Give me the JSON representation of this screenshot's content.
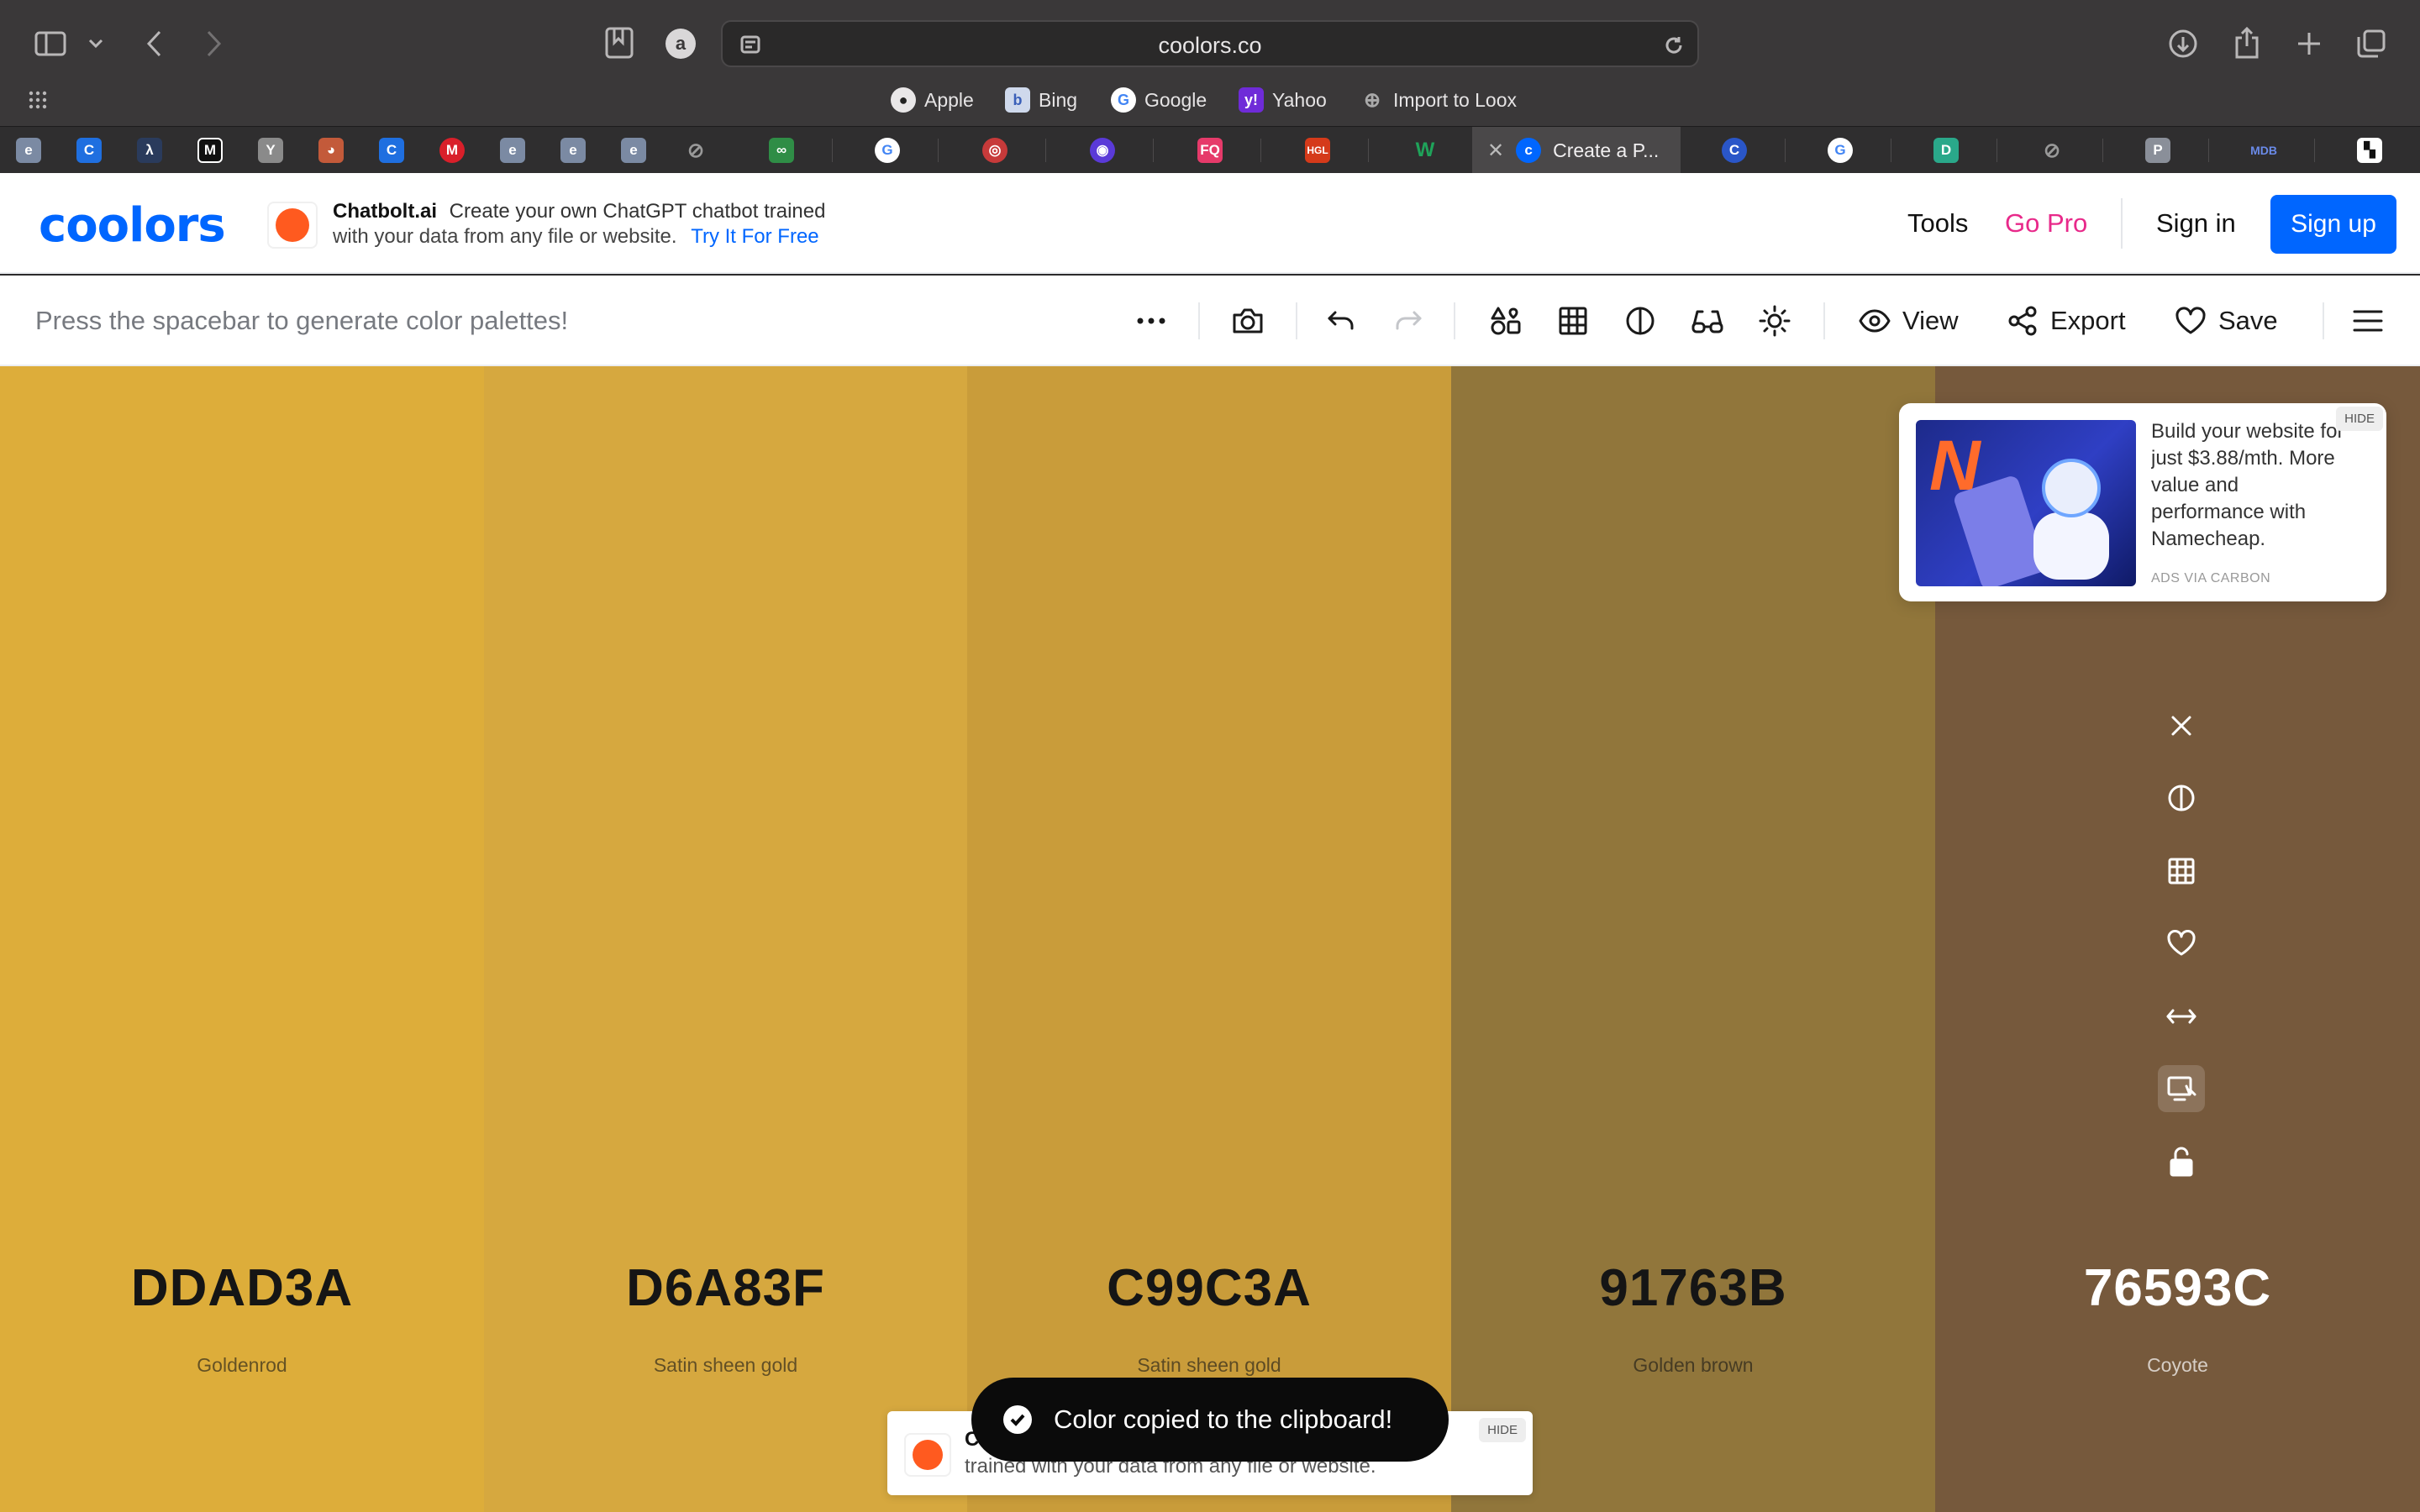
{
  "browser": {
    "url": "coolors.co",
    "bookmarks": [
      {
        "label": "Apple",
        "icon": "apple-icon"
      },
      {
        "label": "Bing",
        "icon": "bing-icon"
      },
      {
        "label": "Google",
        "icon": "google-icon"
      },
      {
        "label": "Yahoo",
        "icon": "yahoo-icon"
      },
      {
        "label": "Import to Loox",
        "icon": "globe-icon"
      }
    ],
    "active_tab": {
      "label": "Create a P..."
    }
  },
  "header": {
    "logo": "coolors",
    "promo": {
      "brand": "Chatbolt.ai",
      "line1": "Create your own ChatGPT chatbot trained",
      "line2": "with your data from any file or website.",
      "cta": "Try It For Free"
    },
    "nav": {
      "tools": "Tools",
      "go_pro": "Go Pro",
      "sign_in": "Sign in",
      "sign_up": "Sign up"
    }
  },
  "generator": {
    "hint": "Press the spacebar to generate color palettes!",
    "view": "View",
    "export": "Export",
    "save": "Save"
  },
  "palette": [
    {
      "hex": "DDAD3A",
      "name": "Goldenrod",
      "color": "#DDAD3A"
    },
    {
      "hex": "D6A83F",
      "name": "Satin sheen gold",
      "color": "#D6A83F"
    },
    {
      "hex": "C99C3A",
      "name": "Satin sheen gold",
      "color": "#C99C3A"
    },
    {
      "hex": "91763B",
      "name": "Golden brown",
      "color": "#91763B"
    },
    {
      "hex": "76593C",
      "name": "Coyote",
      "color": "#76593C"
    }
  ],
  "ad": {
    "text": "Build your website for just $3.88/mth. More value and performance with Namecheap.",
    "via": "ADS VIA CARBON",
    "hide": "HIDE"
  },
  "bottom_promo": {
    "title": "Chatbolt.ai",
    "subtitle": "trained with your data from any file or website.",
    "hide": "HIDE"
  },
  "toast": {
    "message": "Color copied to the clipboard!"
  }
}
